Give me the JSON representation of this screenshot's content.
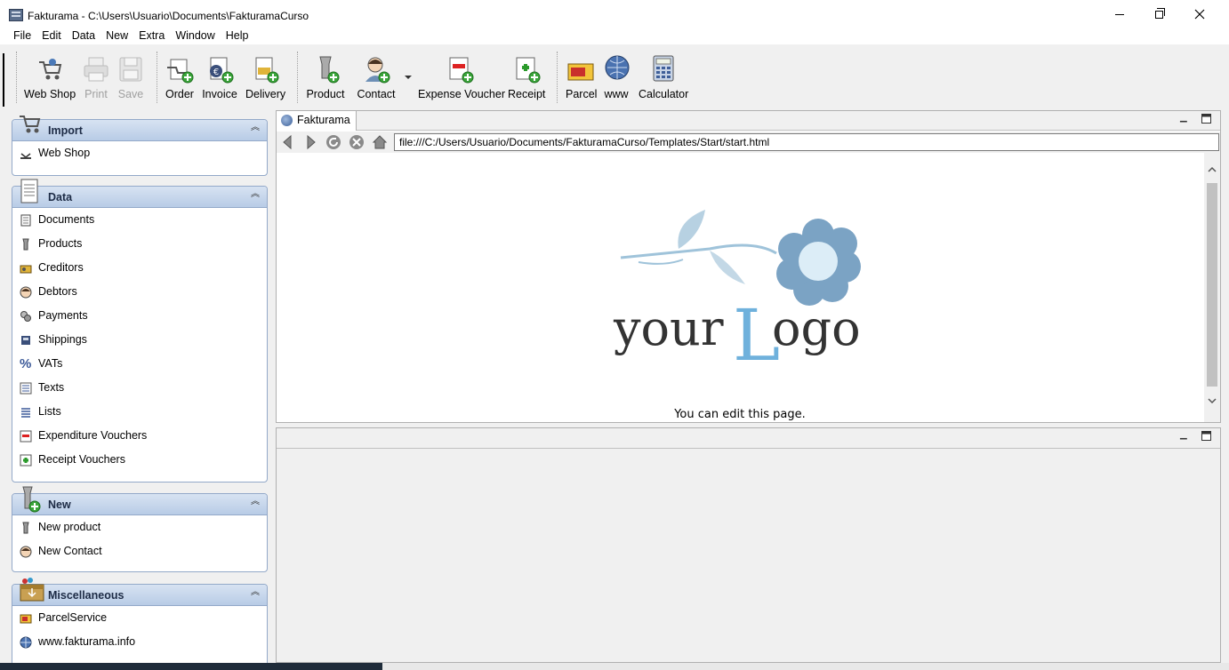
{
  "window": {
    "title": "Fakturama - C:\\Users\\Usuario\\Documents\\FakturamaCurso"
  },
  "menu": [
    "File",
    "Edit",
    "Data",
    "New",
    "Extra",
    "Window",
    "Help"
  ],
  "toolbar": {
    "items": [
      {
        "label": "Web Shop",
        "icon": "web-shop-icon",
        "enabled": true
      },
      {
        "label": "Print",
        "icon": "printer-icon",
        "enabled": false
      },
      {
        "label": "Save",
        "icon": "save-icon",
        "enabled": false
      },
      {
        "label": "Order",
        "icon": "order-icon",
        "enabled": true
      },
      {
        "label": "Invoice",
        "icon": "invoice-icon",
        "enabled": true
      },
      {
        "label": "Delivery",
        "icon": "delivery-icon",
        "enabled": true
      },
      {
        "label": "Product",
        "icon": "product-icon",
        "enabled": true
      },
      {
        "label": "Contact",
        "icon": "contact-icon",
        "enabled": true
      },
      {
        "label": "Expense Voucher",
        "icon": "expense-voucher-icon",
        "enabled": true
      },
      {
        "label": "Receipt",
        "icon": "receipt-icon",
        "enabled": true
      },
      {
        "label": "Parcel",
        "icon": "parcel-icon",
        "enabled": true
      },
      {
        "label": "www",
        "icon": "globe-icon",
        "enabled": true
      },
      {
        "label": "Calculator",
        "icon": "calculator-icon",
        "enabled": true
      }
    ]
  },
  "sidebar": {
    "groups": [
      {
        "title": "Import",
        "items": [
          {
            "label": "Web Shop"
          }
        ]
      },
      {
        "title": "Data",
        "items": [
          {
            "label": "Documents"
          },
          {
            "label": "Products"
          },
          {
            "label": "Creditors"
          },
          {
            "label": "Debtors"
          },
          {
            "label": "Payments"
          },
          {
            "label": "Shippings"
          },
          {
            "label": "VATs"
          },
          {
            "label": "Texts"
          },
          {
            "label": "Lists"
          },
          {
            "label": "Expenditure Vouchers"
          },
          {
            "label": "Receipt Vouchers"
          }
        ]
      },
      {
        "title": "New",
        "items": [
          {
            "label": "New product"
          },
          {
            "label": "New Contact"
          }
        ]
      },
      {
        "title": "Miscellaneous",
        "items": [
          {
            "label": "ParcelService"
          },
          {
            "label": "www.fakturama.info"
          }
        ]
      }
    ]
  },
  "browser": {
    "tab_label": "Fakturama",
    "url": "file:///C:/Users/Usuario/Documents/FakturamaCurso/Templates/Start/start.html",
    "logo_text_your": "your",
    "logo_text_L": "L",
    "logo_text_ogo": "ogo",
    "edit_note": "You can edit this page."
  },
  "colors": {
    "group_header_top": "#d7e3f2",
    "group_header_bottom": "#b8cce6",
    "group_border": "#93a9c9",
    "logo_blue": "#6fb1dc",
    "logo_flower": "#7ba3c4"
  }
}
